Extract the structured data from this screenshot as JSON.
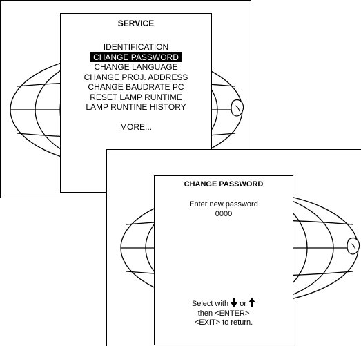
{
  "service_menu": {
    "title": "SERVICE",
    "items": [
      {
        "label": "IDENTIFICATION",
        "selected": false
      },
      {
        "label": "CHANGE PASSWORD",
        "selected": true
      },
      {
        "label": "CHANGE LANGUAGE",
        "selected": false
      },
      {
        "label": "CHANGE PROJ. ADDRESS",
        "selected": false
      },
      {
        "label": "CHANGE BAUDRATE PC",
        "selected": false
      },
      {
        "label": "RESET LAMP RUNTIME",
        "selected": false
      },
      {
        "label": "LAMP RUNTINE HISTORY",
        "selected": false
      }
    ],
    "more_label": "MORE..."
  },
  "password_dialog": {
    "title": "CHANGE PASSWORD",
    "prompt": "Enter new password",
    "value": "0000",
    "hint_select_prefix": "Select with",
    "hint_or": "or",
    "hint_enter": "then <ENTER>",
    "hint_exit": "<EXIT> to return.",
    "down_arrow_icon": "arrow-down-icon",
    "up_arrow_icon": "arrow-up-icon"
  }
}
